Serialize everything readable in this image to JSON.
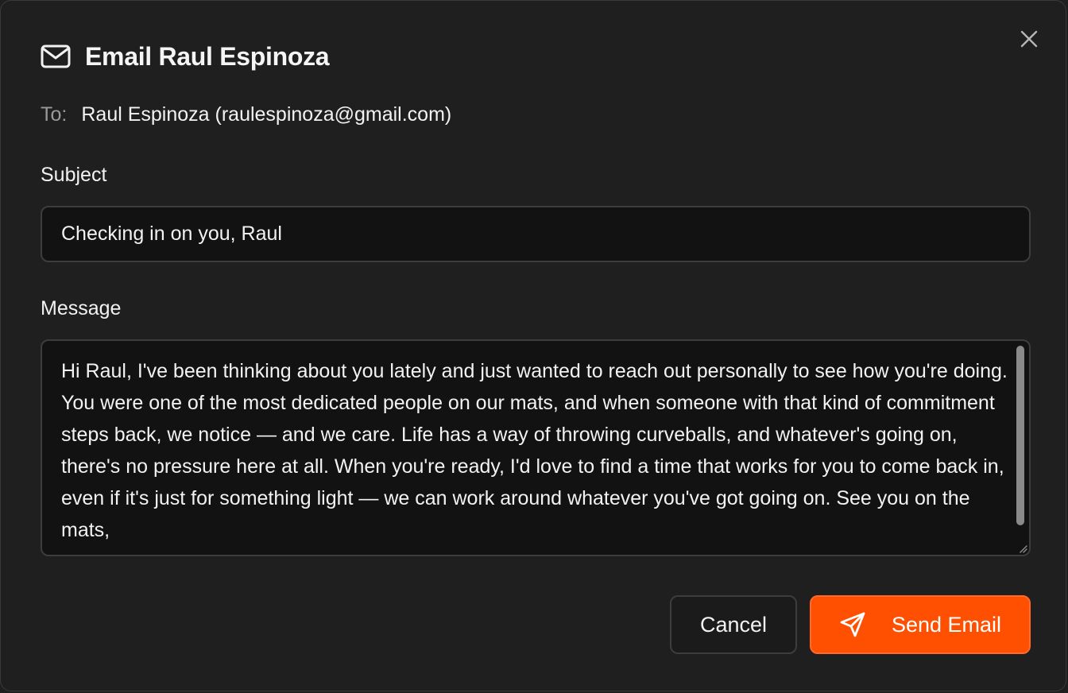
{
  "dialog": {
    "title": "Email Raul Espinoza",
    "to_label": "To:",
    "to_value": "Raul Espinoza (raulespinoza@gmail.com)",
    "subject_label": "Subject",
    "subject_value": "Checking in on you, Raul",
    "message_label": "Message",
    "message_value": "Hi Raul, I've been thinking about you lately and just wanted to reach out personally to see how you're doing. You were one of the most dedicated people on our mats, and when someone with that kind of commitment steps back, we notice — and we care. Life has a way of throwing curveballs, and whatever's going on, there's no pressure here at all. When you're ready, I'd love to find a time that works for you to come back in, even if it's just for something light — we can work around whatever you've got going on. See you on the mats,",
    "cancel_label": "Cancel",
    "send_label": "Send Email"
  },
  "icons": {
    "header": "mail-icon",
    "close": "close-icon",
    "send": "send-icon"
  },
  "colors": {
    "background": "#1f1f1f",
    "input_background": "#121212",
    "border": "#3d3d3d",
    "accent": "#ff4f00",
    "muted_text": "#9a9a9a"
  }
}
